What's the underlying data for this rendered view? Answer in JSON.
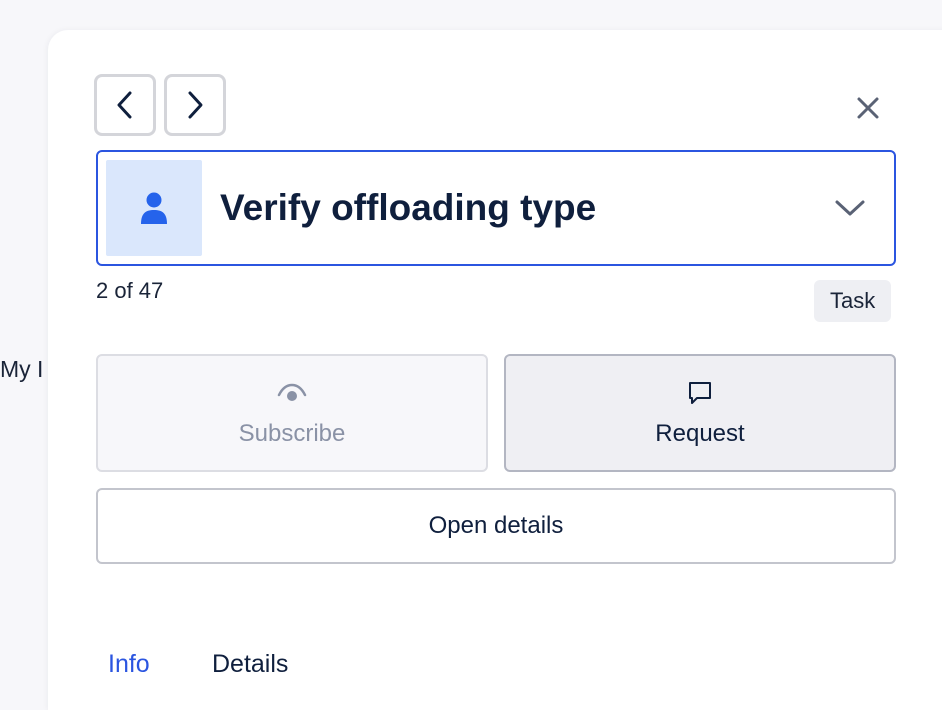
{
  "background": {
    "partial_text": "My I"
  },
  "nav": {
    "prev_icon": "chevron-left-icon",
    "next_icon": "chevron-right-icon",
    "close_icon": "close-icon"
  },
  "selector": {
    "title": "Verify offloading type",
    "avatar_icon": "user-icon",
    "expand_icon": "chevron-down-icon"
  },
  "counter": "2 of 47",
  "badge": "Task",
  "actions": {
    "subscribe_label": "Subscribe",
    "subscribe_icon": "eye-icon",
    "request_label": "Request",
    "request_icon": "comment-icon"
  },
  "open_details_label": "Open details",
  "tabs": [
    {
      "label": "Info",
      "active": true
    },
    {
      "label": "Details",
      "active": false
    }
  ],
  "colors": {
    "accent": "#2b55e0",
    "avatar_bg": "#dae7fc",
    "avatar_icon": "#2563eb",
    "text": "#0f1f3d",
    "muted": "#8a92a6"
  }
}
